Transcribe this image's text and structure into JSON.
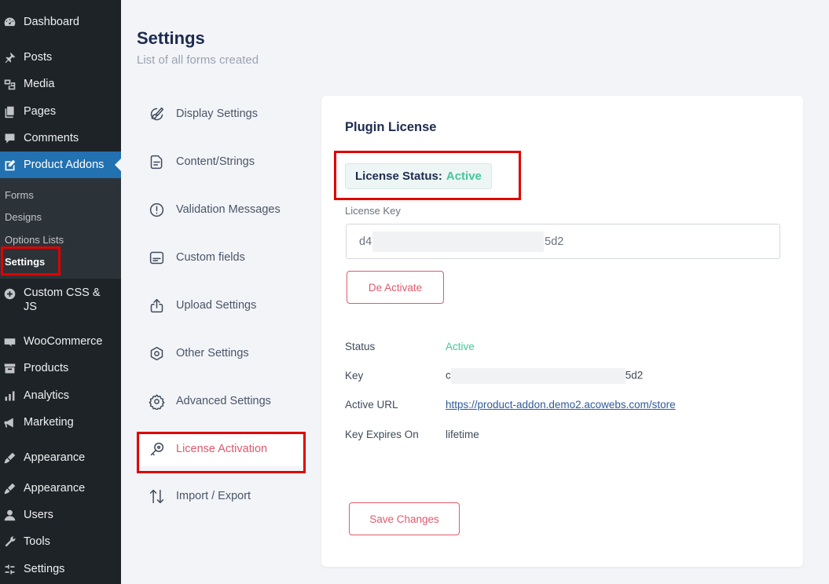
{
  "wp_menu": {
    "dashboard": "Dashboard",
    "posts": "Posts",
    "media": "Media",
    "pages": "Pages",
    "comments": "Comments",
    "product_addons": "Product Addons",
    "submenu": [
      "Forms",
      "Designs",
      "Options Lists",
      "Settings"
    ],
    "custom_css_js": "Custom CSS & JS",
    "woocommerce": "WooCommerce",
    "products": "Products",
    "analytics": "Analytics",
    "marketing": "Marketing",
    "appearance_1": "Appearance",
    "appearance_2": "Appearance",
    "users": "Users",
    "tools": "Tools",
    "settings": "Settings"
  },
  "header": {
    "title": "Settings",
    "subtitle": "List of all forms created"
  },
  "settings_nav": [
    {
      "label": "Display Settings",
      "icon": "brush-icon"
    },
    {
      "label": "Content/Strings",
      "icon": "document-icon"
    },
    {
      "label": "Validation Messages",
      "icon": "alert-circle-icon"
    },
    {
      "label": "Custom fields",
      "icon": "custom-field-icon"
    },
    {
      "label": "Upload Settings",
      "icon": "upload-icon"
    },
    {
      "label": "Other Settings",
      "icon": "hexagon-icon"
    },
    {
      "label": "Advanced Settings",
      "icon": "gear-icon"
    },
    {
      "label": "License Activation",
      "icon": "key-icon"
    },
    {
      "label": "Import / Export",
      "icon": "arrows-updown-icon"
    }
  ],
  "license": {
    "card_title": "Plugin License",
    "status_label": "License Status:",
    "status_value": "Active",
    "key_label": "License Key",
    "key_prefix": "d4",
    "key_suffix": "5d2",
    "deactivate_button": "De Activate",
    "info": {
      "status_label": "Status",
      "status_value": "Active",
      "key_label": "Key",
      "key_prefix": "c",
      "key_suffix": "5d2",
      "url_label": "Active URL",
      "url_value": "https://product-addon.demo2.acowebs.com/store",
      "expires_label": "Key Expires On",
      "expires_value": "lifetime"
    },
    "save_button": "Save Changes"
  },
  "colors": {
    "wp_sidebar": "#1d2327",
    "wp_active": "#2271b1",
    "accent_pink": "#e05a6c",
    "active_green": "#45c69a",
    "highlight_red": "#e00000"
  }
}
